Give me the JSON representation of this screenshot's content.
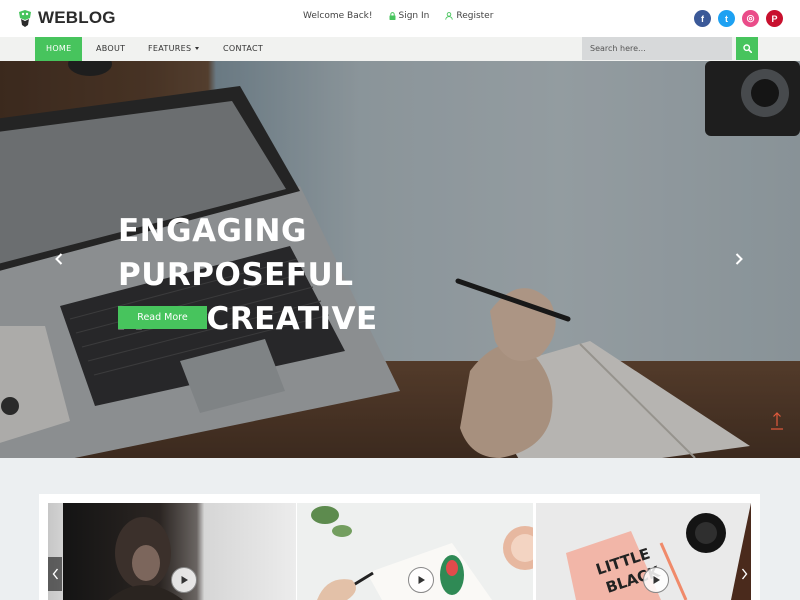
{
  "brand": {
    "name": "WEBLOG"
  },
  "toplinks": {
    "welcome": "Welcome Back!",
    "signin": "Sign In",
    "register": "Register"
  },
  "socials": [
    {
      "icon": "facebook-icon",
      "glyph": "f",
      "color": "#3b5998"
    },
    {
      "icon": "twitter-icon",
      "glyph": "t",
      "color": "#1da1f2"
    },
    {
      "icon": "dribbble-icon",
      "glyph": "◎",
      "color": "#ea4c89"
    },
    {
      "icon": "pinterest-icon",
      "glyph": "P",
      "color": "#c8102e"
    }
  ],
  "nav": {
    "home": "HOME",
    "about": "ABOUT",
    "features": "FEATURES",
    "contact": "CONTACT"
  },
  "search": {
    "placeholder": "Search here..."
  },
  "hero": {
    "title_line1": "ENGAGING PURPOSEFUL",
    "title_line2": "AND CREATIVE",
    "button": "Read More"
  },
  "colors": {
    "accent": "#47c45d"
  }
}
